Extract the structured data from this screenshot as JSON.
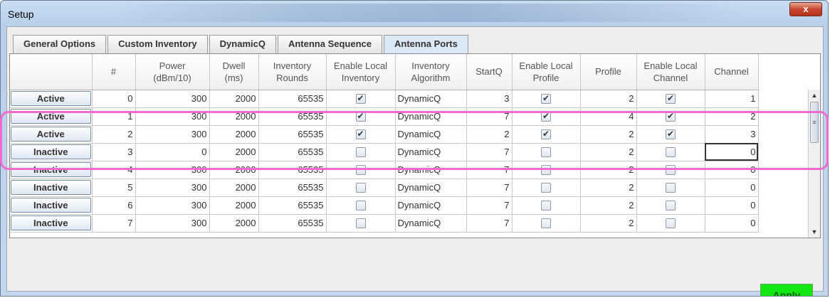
{
  "window": {
    "title": "Setup",
    "close_label": "x"
  },
  "tabs": [
    {
      "label": "General Options",
      "active": false
    },
    {
      "label": "Custom Inventory",
      "active": false
    },
    {
      "label": "DynamicQ",
      "active": false
    },
    {
      "label": "Antenna Sequence",
      "active": false
    },
    {
      "label": "Antenna Ports",
      "active": true
    }
  ],
  "table": {
    "headers": [
      "",
      "#",
      "Power\n(dBm/10)",
      "Dwell\n(ms)",
      "Inventory\nRounds",
      "Enable Local\nInventory",
      "Inventory\nAlgorithm",
      "StartQ",
      "Enable Local\nProfile",
      "Profile",
      "Enable Local\nChannel",
      "Channel"
    ],
    "rows": [
      {
        "state": "Active",
        "num": "0",
        "power": "300",
        "dwell": "2000",
        "rounds": "65535",
        "enable_inventory": true,
        "algorithm": "DynamicQ",
        "startq": "3",
        "enable_profile": true,
        "profile": "2",
        "enable_channel": true,
        "channel": "1"
      },
      {
        "state": "Active",
        "num": "1",
        "power": "300",
        "dwell": "2000",
        "rounds": "65535",
        "enable_inventory": true,
        "algorithm": "DynamicQ",
        "startq": "7",
        "enable_profile": true,
        "profile": "4",
        "enable_channel": true,
        "channel": "2"
      },
      {
        "state": "Active",
        "num": "2",
        "power": "300",
        "dwell": "2000",
        "rounds": "65535",
        "enable_inventory": true,
        "algorithm": "DynamicQ",
        "startq": "2",
        "enable_profile": true,
        "profile": "2",
        "enable_channel": true,
        "channel": "3"
      },
      {
        "state": "Inactive",
        "num": "3",
        "power": "0",
        "dwell": "2000",
        "rounds": "65535",
        "enable_inventory": false,
        "algorithm": "DynamicQ",
        "startq": "7",
        "enable_profile": false,
        "profile": "2",
        "enable_channel": false,
        "channel": "0"
      },
      {
        "state": "Inactive",
        "num": "4",
        "power": "300",
        "dwell": "2000",
        "rounds": "65535",
        "enable_inventory": false,
        "algorithm": "DynamicQ",
        "startq": "7",
        "enable_profile": false,
        "profile": "2",
        "enable_channel": false,
        "channel": "0"
      },
      {
        "state": "Inactive",
        "num": "5",
        "power": "300",
        "dwell": "2000",
        "rounds": "65535",
        "enable_inventory": false,
        "algorithm": "DynamicQ",
        "startq": "7",
        "enable_profile": false,
        "profile": "2",
        "enable_channel": false,
        "channel": "0"
      },
      {
        "state": "Inactive",
        "num": "6",
        "power": "300",
        "dwell": "2000",
        "rounds": "65535",
        "enable_inventory": false,
        "algorithm": "DynamicQ",
        "startq": "7",
        "enable_profile": false,
        "profile": "2",
        "enable_channel": false,
        "channel": "0"
      },
      {
        "state": "Inactive",
        "num": "7",
        "power": "300",
        "dwell": "2000",
        "rounds": "65535",
        "enable_inventory": false,
        "algorithm": "DynamicQ",
        "startq": "7",
        "enable_profile": false,
        "profile": "2",
        "enable_channel": false,
        "channel": "0"
      }
    ]
  },
  "apply_label": "Apply",
  "colors": {
    "apply_bg": "#11e811",
    "highlight": "#f06ad0",
    "active_tab": "#dbe8f6"
  }
}
